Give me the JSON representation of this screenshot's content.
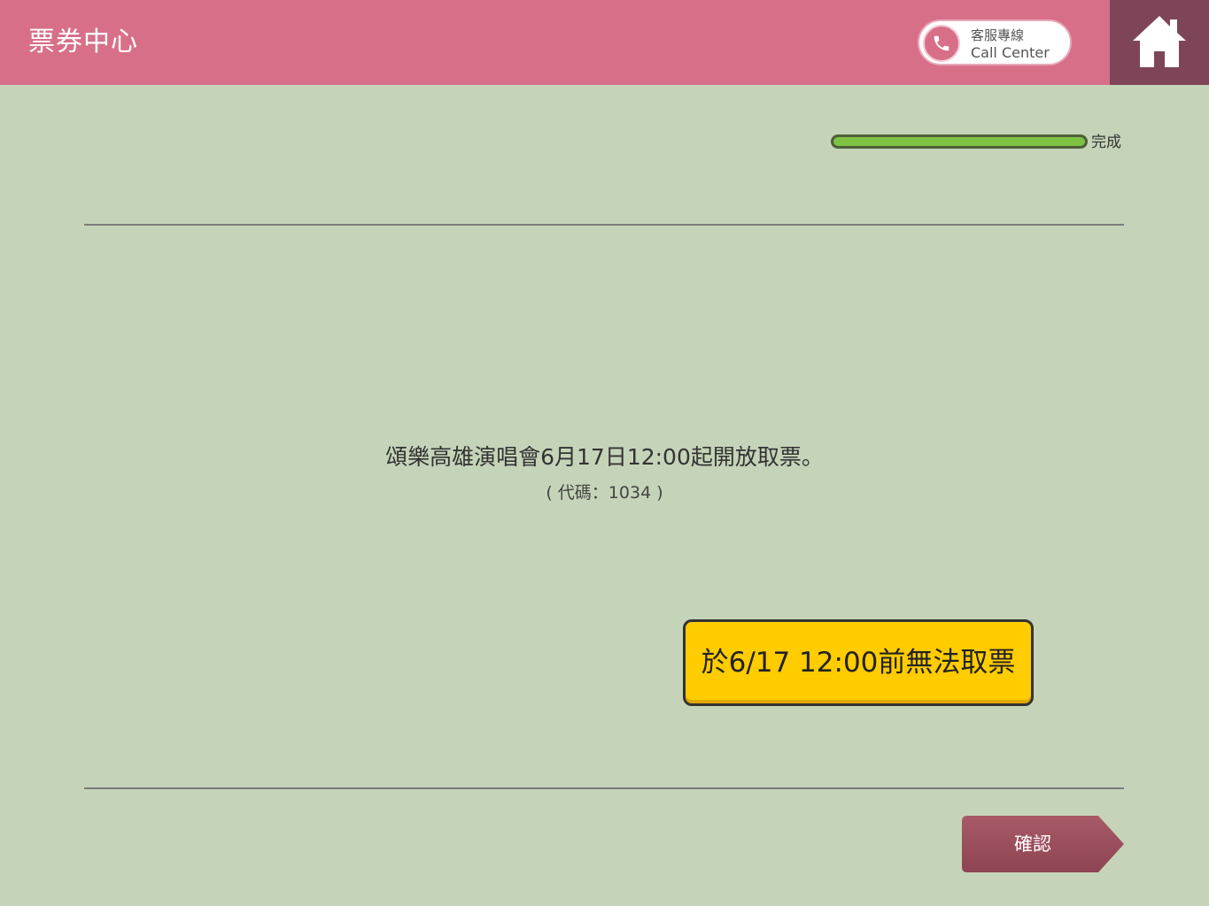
{
  "header": {
    "title": "票券中心",
    "call_center": {
      "line1": "客服專線",
      "line2": "Call Center",
      "icon": "phone-icon"
    },
    "home_icon": "home-icon"
  },
  "progress": {
    "fraction": 1.0,
    "label": "完成"
  },
  "content": {
    "message": "頌樂高雄演唱會6月17日12:00起開放取票。",
    "code": "( 代碼：1034 )"
  },
  "notice_button": {
    "label": "於6/17  12:00前無法取票"
  },
  "footer": {
    "confirm_label": "確認"
  },
  "colors": {
    "header_bg": "#d86f89",
    "home_bg": "#7e4458",
    "page_bg": "#c5d4b8",
    "progress_fill": "#7fc143",
    "notice_bg": "#ffcc00",
    "confirm_bg": "#9c4f5c"
  }
}
